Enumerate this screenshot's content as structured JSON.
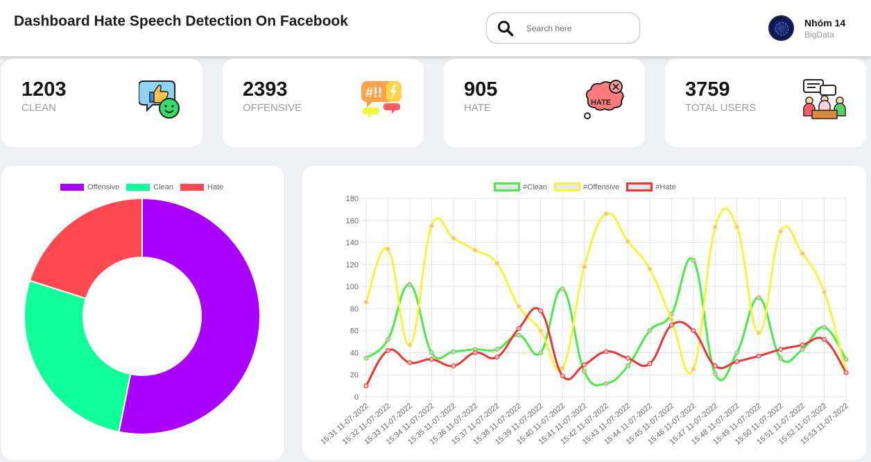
{
  "header": {
    "title": "Dashboard Hate Speech Detection On Facebook",
    "search_placeholder": "Search here",
    "user_name": "Nhóm 14",
    "user_role": "BigData"
  },
  "cards": [
    {
      "value": "1203",
      "label": "CLEAN",
      "icon": "thumbs-up-smile-icon"
    },
    {
      "value": "2393",
      "label": "OFFENSIVE",
      "icon": "hashtag-chat-bubble-icon"
    },
    {
      "value": "905",
      "label": "HATE",
      "icon": "hate-bubble-icon"
    },
    {
      "value": "3759",
      "label": "TOTAL USERS",
      "icon": "people-chat-icon"
    }
  ],
  "colors": {
    "offensive": "#aa00ff",
    "clean": "#11ff99",
    "hate": "#ff4852",
    "line_clean": "#44ee44",
    "line_offensive": "#f5f53a",
    "line_hate": "#ee3333"
  },
  "chart_data": [
    {
      "type": "pie",
      "legend_position": "top",
      "labels": [
        "Offensive",
        "Clean",
        "Hate"
      ],
      "values": [
        2393,
        1203,
        905
      ]
    },
    {
      "type": "line",
      "legend_position": "top",
      "grid": true,
      "ylim": [
        0,
        180
      ],
      "yticks": [
        0,
        20,
        40,
        60,
        80,
        100,
        120,
        140,
        160,
        180
      ],
      "x": [
        "15:31 11-07-2022",
        "15:32 11-07-2022",
        "15:33 11-07-2022",
        "15:34 11-07-2022",
        "15:35 11-07-2022",
        "15:36 11-07-2022",
        "15:37 11-07-2022",
        "15:38 11-07-2022",
        "15:39 11-07-2022",
        "15:40 11-07-2022",
        "15:41 11-07-2022",
        "15:42 11-07-2022",
        "15:43 11-07-2022",
        "15:44 11-07-2022",
        "15:45 11-07-2022",
        "15:46 11-07-2022",
        "15:47 11-07-2022",
        "15:48 11-07-2022",
        "15:49 11-07-2022",
        "15:50 11-07-2022",
        "15:51 11-07-2022",
        "15:52 11-07-2022",
        "15:53 11-07-2022"
      ],
      "series": [
        {
          "name": "#Clean",
          "values": [
            35,
            52,
            102,
            40,
            41,
            43,
            43,
            56,
            40,
            98,
            23,
            12,
            28,
            60,
            75,
            124,
            21,
            40,
            90,
            35,
            43,
            63,
            34
          ]
        },
        {
          "name": "#Offensive",
          "values": [
            86,
            134,
            47,
            155,
            144,
            133,
            121,
            82,
            60,
            26,
            118,
            166,
            141,
            116,
            70,
            25,
            154,
            154,
            58,
            150,
            130,
            95,
            22
          ]
        },
        {
          "name": "#Hate",
          "values": [
            10,
            42,
            31,
            34,
            28,
            40,
            36,
            62,
            78,
            19,
            29,
            41,
            35,
            30,
            65,
            60,
            28,
            32,
            37,
            43,
            47,
            52,
            22
          ]
        }
      ]
    }
  ]
}
